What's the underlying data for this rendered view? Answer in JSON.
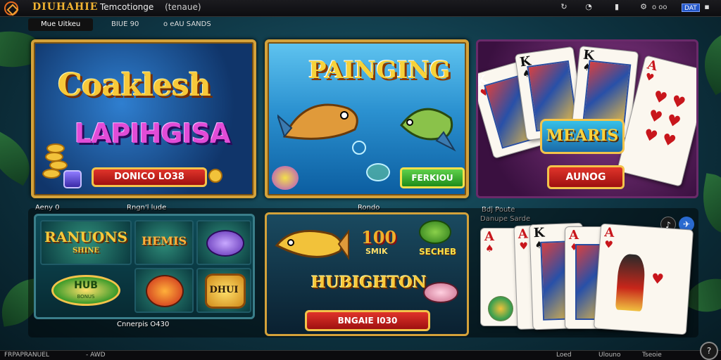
{
  "header": {
    "logo_text": "DIUHAHIE",
    "search_text": "Temcotionge",
    "search_paren": "(tenaue)",
    "dots": "o oo",
    "badge": "DAT"
  },
  "tabs": [
    {
      "label": "Mue Uitkeu"
    },
    {
      "label": "BIUE 90"
    },
    {
      "label": "o eAU SANDS"
    }
  ],
  "panels": {
    "slots": {
      "title_line1": "Coaklesh",
      "title_line2": "LAPIHGISA",
      "button": "DONICO LO38"
    },
    "fishing": {
      "title": "PAINGING",
      "button": "FERKIOU"
    },
    "cards": {
      "badge": "MEARIS",
      "button": "AUNOG"
    }
  },
  "captions": {
    "left_a": "Aeny 0",
    "left_b": "Rngn'l lude",
    "mid": "Rondo",
    "right_a": "Bdj Poute",
    "right_b": "Danupe Sarde",
    "bottom_left": "Cnnerpis O430"
  },
  "lower": {
    "slots": {
      "tile_1": "RANUONS",
      "tile_1_sub": "SHINE",
      "tile_2": "HEMIS",
      "hub": "HUB",
      "hub_sub": "BONUS",
      "tile_6": "DHUI"
    },
    "fishing": {
      "number": "100",
      "number_sub": "SMIK",
      "seg": "SECHEB",
      "banner": "HUBIGHTON",
      "button": "BNGAIE I030"
    }
  },
  "cards": [
    {
      "rank": "K",
      "suit": "♥",
      "color": "red"
    },
    {
      "rank": "K",
      "suit": "♠",
      "color": "blk"
    },
    {
      "rank": "K",
      "suit": "♠",
      "color": "blk"
    },
    {
      "rank": "A",
      "suit": "♥",
      "color": "red"
    }
  ],
  "lower_cards": [
    {
      "rank": "A",
      "suit": "♠",
      "color": "red"
    },
    {
      "rank": "A",
      "suit": "♥",
      "color": "red"
    },
    {
      "rank": "K",
      "suit": "♠",
      "color": "blk"
    },
    {
      "rank": "A",
      "suit": "♦",
      "color": "red"
    },
    {
      "rank": "A",
      "suit": "♥",
      "color": "red"
    }
  ],
  "bottombar": {
    "left": "FRPAPRANUEL",
    "left2": "- AWD",
    "right1": "Loed",
    "right2": "Ulouno",
    "right3": "Tseoie"
  },
  "icons": [
    "logo-icon",
    "refresh-icon",
    "clock-icon",
    "bookmark-icon",
    "settings-icon",
    "music-icon",
    "share-icon",
    "help-icon"
  ]
}
